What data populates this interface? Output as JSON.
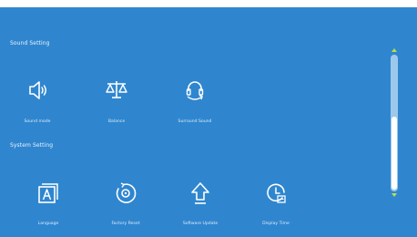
{
  "sections": {
    "sound": {
      "title": "Sound Setting",
      "items": [
        {
          "label": "Sound mode",
          "icon": "speaker-icon"
        },
        {
          "label": "Balance",
          "icon": "balance-scale-icon"
        },
        {
          "label": "Surround Sound",
          "icon": "surround-headphones-icon"
        }
      ]
    },
    "system": {
      "title": "System Setting",
      "items": [
        {
          "label": "Language",
          "icon": "language-letter-icon"
        },
        {
          "label": "Factory Reset",
          "icon": "factory-reset-icon"
        },
        {
          "label": "Software Update",
          "icon": "upload-arrow-icon"
        },
        {
          "label": "Display Time",
          "icon": "clock-icon"
        }
      ]
    }
  },
  "colors": {
    "background": "#2f86cf",
    "scroll_accent": "#b9e04a"
  }
}
